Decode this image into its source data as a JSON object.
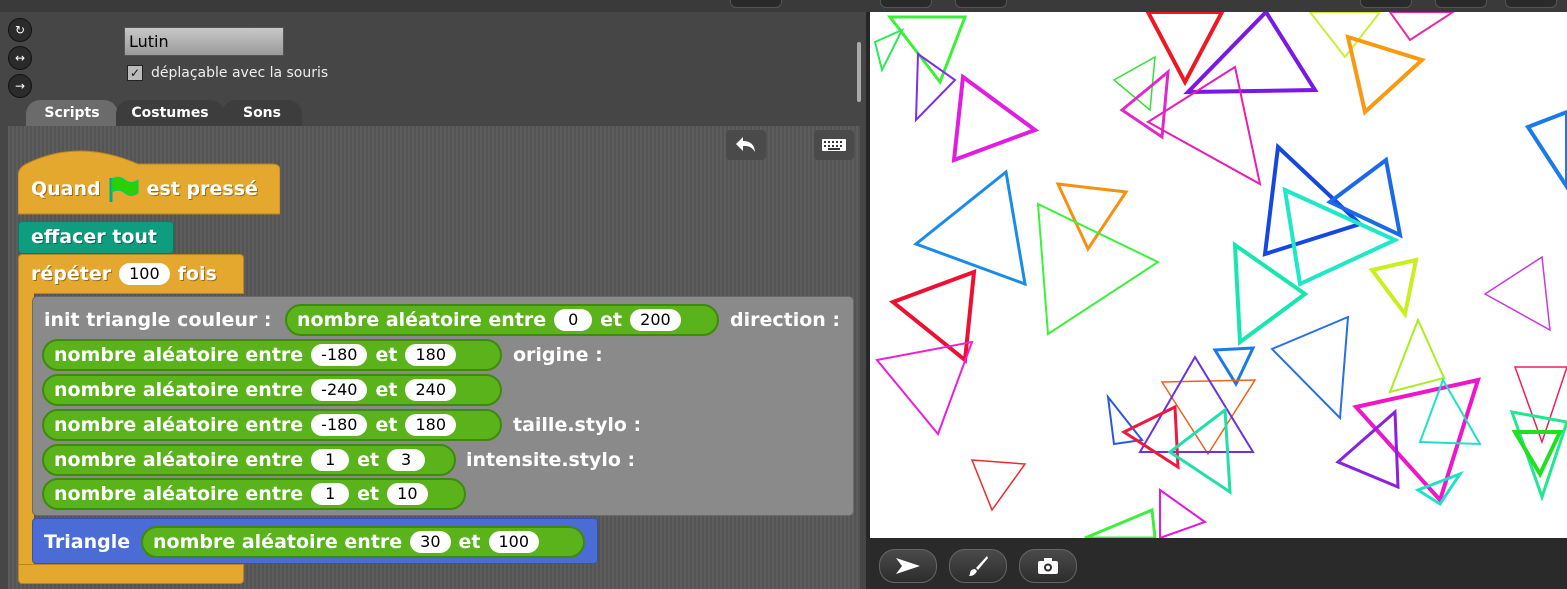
{
  "sprite": {
    "name": "Lutin",
    "draggable_label": "déplaçable avec la souris",
    "draggable_checked": "✓"
  },
  "rotation_buttons": [
    "↻",
    "↔",
    "→"
  ],
  "tabs": [
    {
      "label": "Scripts",
      "active": true
    },
    {
      "label": "Costumes",
      "active": false
    },
    {
      "label": "Sons",
      "active": false
    }
  ],
  "toolbar": {
    "undo_icon": "undo-icon",
    "keyboard_icon": "keyboard-icon"
  },
  "script": {
    "hat": {
      "before": "Quand",
      "after": "est pressé"
    },
    "clear": "effacer tout",
    "repeat": {
      "label": "répéter",
      "count": "100",
      "suffix": "fois"
    },
    "init": {
      "label": "init triangle couleur :",
      "direction": "direction :",
      "origine": "origine :",
      "taille": "taille.stylo :",
      "intensite": "intensite.stylo :"
    },
    "random_label": "nombre aléatoire entre",
    "and_label": "et",
    "randoms": [
      {
        "from": "0",
        "to": "200"
      },
      {
        "from": "-180",
        "to": "180"
      },
      {
        "from": "-240",
        "to": "240"
      },
      {
        "from": "-180",
        "to": "180"
      },
      {
        "from": "1",
        "to": "3"
      },
      {
        "from": "1",
        "to": "10"
      },
      {
        "from": "30",
        "to": "100"
      }
    ],
    "triangle": "Triangle"
  },
  "stage_buttons": [
    "pointer-icon",
    "brush-icon",
    "camera-icon"
  ],
  "colors": {
    "hat": "#e5a82e",
    "pen": "#0f9d7f",
    "operator": "#5ab31a",
    "custom": "#4a6cd4",
    "custom_gray": "#8a8a8a"
  }
}
